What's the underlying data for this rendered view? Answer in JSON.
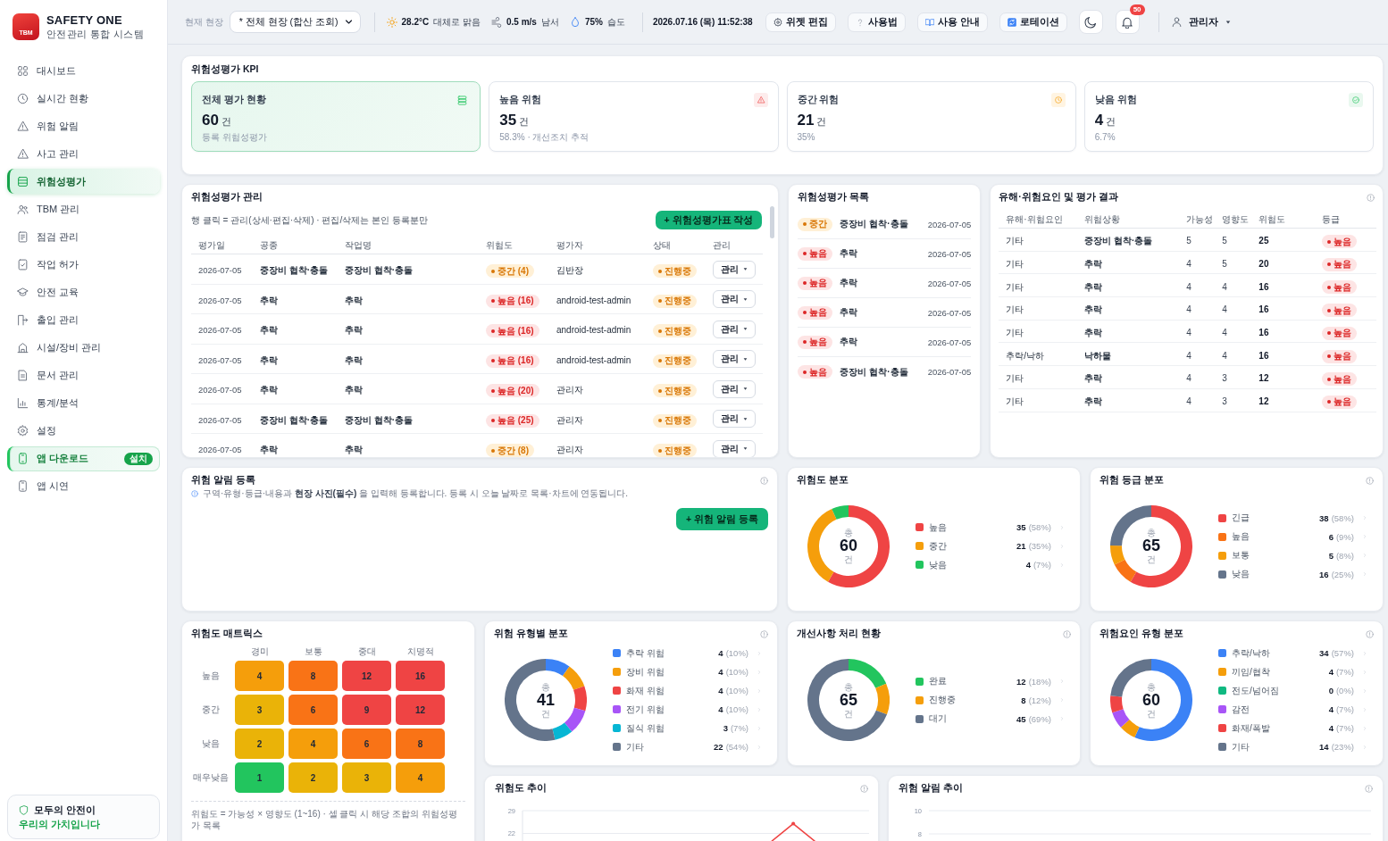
{
  "sidebar": {
    "logo_text": "TBM",
    "title": "SAFETY ONE",
    "subtitle": "안전관리 통합 시스템",
    "nav": [
      {
        "label": "대시보드",
        "selected": false,
        "highlighted": false
      },
      {
        "label": "실시간 현황",
        "selected": false,
        "highlighted": false
      },
      {
        "label": "위험 알림",
        "selected": false,
        "highlighted": false
      },
      {
        "label": "사고 관리",
        "selected": false,
        "highlighted": false
      },
      {
        "label": "위험성평가",
        "selected": true,
        "highlighted": false
      },
      {
        "label": "TBM 관리",
        "selected": false,
        "highlighted": false
      },
      {
        "label": "점검 관리",
        "selected": false,
        "highlighted": false
      },
      {
        "label": "작업 허가",
        "selected": false,
        "highlighted": false
      },
      {
        "label": "안전 교육",
        "selected": false,
        "highlighted": false
      },
      {
        "label": "출입 관리",
        "selected": false,
        "highlighted": false
      },
      {
        "label": "시설/장비 관리",
        "selected": false,
        "highlighted": false
      },
      {
        "label": "문서 관리",
        "selected": false,
        "highlighted": false
      },
      {
        "label": "통계/분석",
        "selected": false,
        "highlighted": false
      },
      {
        "label": "설정",
        "selected": false,
        "highlighted": false
      },
      {
        "label": "앱 다운로드",
        "selected": false,
        "highlighted": true,
        "badge": "설치"
      },
      {
        "label": "앱 시연",
        "selected": false,
        "highlighted": false
      }
    ],
    "slogan": {
      "line1": "모두의 안전이",
      "line2": "우리의 가치입니다"
    }
  },
  "header": {
    "site_label": "현재 현장",
    "site_select": "* 전체 현장 (합산 조회)",
    "weather": [
      {
        "value": "28.2°C",
        "text": "대체로 맑음"
      },
      {
        "value": "0.5 m/s",
        "text": "남서"
      },
      {
        "value": "75%",
        "text": "습도"
      }
    ],
    "datetime": "2026.07.16 (목) 11:52:38",
    "buttons": [
      "위젯 편집",
      "사용법",
      "사용 안내",
      "로테이션"
    ],
    "notification_count": "50",
    "user": "관리자"
  },
  "kpi": {
    "title": "위험성평가 KPI",
    "items": [
      {
        "kind": "total",
        "title": "전체 평가 현황",
        "value": "60",
        "unit": "건",
        "caption": "등록 위험성평가",
        "selected": true
      },
      {
        "kind": "high",
        "title": "높음 위험",
        "value": "35",
        "unit": "건",
        "caption": "58.3% · 개선조치 추적",
        "selected": false
      },
      {
        "kind": "medium",
        "title": "중간 위험",
        "value": "21",
        "unit": "건",
        "caption": "35%",
        "selected": false
      },
      {
        "kind": "low",
        "title": "낮음 위험",
        "value": "4",
        "unit": "건",
        "caption": "6.7%",
        "selected": false
      }
    ]
  },
  "assessment_table": {
    "title": "위험성평가 관리",
    "hint": "행 클릭 = 관리(상세·편집·삭제) · 편집/삭제는 본인 등록분만",
    "create_button": "+ 위험성평가표 작성",
    "columns": [
      "평가일",
      "공종",
      "작업명",
      "위험도",
      "평가자",
      "상태",
      "관리"
    ],
    "rows": [
      {
        "date": "2026-07-05",
        "trade": "중장비 협착·충돌",
        "task": "중장비 협착·충돌",
        "risk": {
          "label": "중간 (4)",
          "kind": "medium"
        },
        "assessor": "김반장",
        "status": {
          "label": "진행중",
          "kind": "ongoing"
        },
        "action": "관리"
      },
      {
        "date": "2026-07-05",
        "trade": "추락",
        "task": "추락",
        "risk": {
          "label": "높음 (16)",
          "kind": "high"
        },
        "assessor": "android-test-admin",
        "status": {
          "label": "진행중",
          "kind": "ongoing"
        },
        "action": "관리"
      },
      {
        "date": "2026-07-05",
        "trade": "추락",
        "task": "추락",
        "risk": {
          "label": "높음 (16)",
          "kind": "high"
        },
        "assessor": "android-test-admin",
        "status": {
          "label": "진행중",
          "kind": "ongoing"
        },
        "action": "관리"
      },
      {
        "date": "2026-07-05",
        "trade": "추락",
        "task": "추락",
        "risk": {
          "label": "높음 (16)",
          "kind": "high"
        },
        "assessor": "android-test-admin",
        "status": {
          "label": "진행중",
          "kind": "ongoing"
        },
        "action": "관리"
      },
      {
        "date": "2026-07-05",
        "trade": "추락",
        "task": "추락",
        "risk": {
          "label": "높음 (20)",
          "kind": "high"
        },
        "assessor": "관리자",
        "status": {
          "label": "진행중",
          "kind": "ongoing"
        },
        "action": "관리"
      },
      {
        "date": "2026-07-05",
        "trade": "중장비 협착·충돌",
        "task": "중장비 협착·충돌",
        "risk": {
          "label": "높음 (25)",
          "kind": "high"
        },
        "assessor": "관리자",
        "status": {
          "label": "진행중",
          "kind": "ongoing"
        },
        "action": "관리"
      },
      {
        "date": "2026-07-05",
        "trade": "추락",
        "task": "추락",
        "risk": {
          "label": "중간 (8)",
          "kind": "medium"
        },
        "assessor": "관리자",
        "status": {
          "label": "진행중",
          "kind": "ongoing"
        },
        "action": "관리"
      }
    ]
  },
  "assessment_list": {
    "title": "위험성평가 목록",
    "items": [
      {
        "kind": "medium",
        "badge": "중간",
        "title": "중장비 협착·충돌",
        "date": "2026-07-05"
      },
      {
        "kind": "high",
        "badge": "높음",
        "title": "추락",
        "date": "2026-07-05"
      },
      {
        "kind": "high",
        "badge": "높음",
        "title": "추락",
        "date": "2026-07-05"
      },
      {
        "kind": "high",
        "badge": "높음",
        "title": "추락",
        "date": "2026-07-05"
      },
      {
        "kind": "high",
        "badge": "높음",
        "title": "추락",
        "date": "2026-07-05"
      },
      {
        "kind": "high",
        "badge": "높음",
        "title": "중장비 협착·충돌",
        "date": "2026-07-05"
      }
    ]
  },
  "hazard_results": {
    "title": "유해·위험요인 및 평가 결과",
    "info": true,
    "columns": [
      "유해·위험요인",
      "위험상황",
      "가능성",
      "영향도",
      "위험도",
      "등급"
    ],
    "rows": [
      {
        "factor": "기타",
        "situation": "중장비 협착·충돌",
        "likelihood": "5",
        "impact": "5",
        "risk": "25",
        "grade": {
          "label": "높음",
          "kind": "high"
        }
      },
      {
        "factor": "기타",
        "situation": "추락",
        "likelihood": "4",
        "impact": "5",
        "risk": "20",
        "grade": {
          "label": "높음",
          "kind": "high"
        }
      },
      {
        "factor": "기타",
        "situation": "추락",
        "likelihood": "4",
        "impact": "4",
        "risk": "16",
        "grade": {
          "label": "높음",
          "kind": "high"
        }
      },
      {
        "factor": "기타",
        "situation": "추락",
        "likelihood": "4",
        "impact": "4",
        "risk": "16",
        "grade": {
          "label": "높음",
          "kind": "high"
        }
      },
      {
        "factor": "기타",
        "situation": "추락",
        "likelihood": "4",
        "impact": "4",
        "risk": "16",
        "grade": {
          "label": "높음",
          "kind": "high"
        }
      },
      {
        "factor": "추락/낙하",
        "situation": "낙하물",
        "likelihood": "4",
        "impact": "4",
        "risk": "16",
        "grade": {
          "label": "높음",
          "kind": "high"
        }
      },
      {
        "factor": "기타",
        "situation": "추락",
        "likelihood": "4",
        "impact": "3",
        "risk": "12",
        "grade": {
          "label": "높음",
          "kind": "high"
        }
      },
      {
        "factor": "기타",
        "situation": "추락",
        "likelihood": "4",
        "impact": "3",
        "risk": "12",
        "grade": {
          "label": "높음",
          "kind": "high"
        }
      }
    ]
  },
  "alert_registration": {
    "title": "위험 알림 등록",
    "info": true,
    "hint": "구역·유형·등급·내용과 **현장 사진(필수)** 을 입력해 등록합니다. 등록 시 오늘 날짜로 목록·차트에 연동됩니다.",
    "button": "+ 위험 알림 등록"
  },
  "donut_cards": [
    {
      "title": "위험도 분포",
      "info": false,
      "total_label": "총",
      "total": "60",
      "total_unit": "건",
      "chart_data": {
        "type": "donut",
        "categories": [
          "높음",
          "중간",
          "낮음"
        ],
        "values": [
          58.33,
          35,
          6.67
        ],
        "legend": "right"
      },
      "legend": [
        {
          "count": "35",
          "share": "(58%)",
          "color": "#ef4444"
        },
        {
          "count": "21",
          "share": "(35%)",
          "color": "#f59e0b"
        },
        {
          "count": "4",
          "share": "(7%)",
          "color": "#22c55e"
        }
      ]
    },
    {
      "title": "위험 등급 분포",
      "info": true,
      "total_label": "총",
      "total": "65",
      "total_unit": "건",
      "chart_data": {
        "type": "donut",
        "categories": [
          "긴급",
          "높음",
          "보통",
          "낮음"
        ],
        "values": [
          58.46,
          9.23,
          7.69,
          24.62
        ],
        "legend": "right"
      },
      "legend": [
        {
          "count": "38",
          "share": "(58%)",
          "color": "#ef4444"
        },
        {
          "count": "6",
          "share": "(9%)",
          "color": "#f97316"
        },
        {
          "count": "5",
          "share": "(8%)",
          "color": "#f59e0b"
        },
        {
          "count": "16",
          "share": "(25%)",
          "color": "#64748b"
        }
      ]
    },
    {
      "title": "위험 유형별 분포",
      "info": true,
      "total_label": "총",
      "total": "41",
      "total_unit": "건",
      "chart_data": {
        "type": "donut",
        "categories": [
          "추락 위험",
          "장비 위험",
          "화재 위험",
          "전기 위험",
          "질식 위험",
          "기타"
        ],
        "values": [
          9.76,
          9.76,
          9.76,
          9.76,
          7.32,
          53.64
        ],
        "legend": "right"
      },
      "legend": [
        {
          "count": "4",
          "share": "(10%)",
          "color": "#3b82f6"
        },
        {
          "count": "4",
          "share": "(10%)",
          "color": "#f59e0b"
        },
        {
          "count": "4",
          "share": "(10%)",
          "color": "#ef4444"
        },
        {
          "count": "4",
          "share": "(10%)",
          "color": "#a855f7"
        },
        {
          "count": "3",
          "share": "(7%)",
          "color": "#06b6d4"
        },
        {
          "count": "22",
          "share": "(54%)",
          "color": "#64748b"
        }
      ]
    },
    {
      "title": "개선사항 처리 현황",
      "info": true,
      "total_label": "총",
      "total": "65",
      "total_unit": "건",
      "chart_data": {
        "type": "donut",
        "categories": [
          "완료",
          "진행중",
          "대기"
        ],
        "values": [
          18.46,
          12.31,
          69.23
        ],
        "legend": "right"
      },
      "legend": [
        {
          "count": "12",
          "share": "(18%)",
          "color": "#22c55e"
        },
        {
          "count": "8",
          "share": "(12%)",
          "color": "#f59e0b"
        },
        {
          "count": "45",
          "share": "(69%)",
          "color": "#64748b"
        }
      ]
    },
    {
      "title": "위험요인 유형 분포",
      "info": true,
      "total_label": "총",
      "total": "60",
      "total_unit": "건",
      "chart_data": {
        "type": "donut",
        "categories": [
          "추락/낙하",
          "끼임/협착",
          "전도/넘어짐",
          "감전",
          "화재/폭발",
          "기타"
        ],
        "values": [
          56.66,
          6.67,
          0,
          6.67,
          6.67,
          23.33
        ],
        "legend": "right"
      },
      "legend": [
        {
          "count": "34",
          "share": "(57%)",
          "color": "#3b82f6"
        },
        {
          "count": "4",
          "share": "(7%)",
          "color": "#f59e0b"
        },
        {
          "count": "0",
          "share": "(0%)",
          "color": "#10b981"
        },
        {
          "count": "4",
          "share": "(7%)",
          "color": "#a855f7"
        },
        {
          "count": "4",
          "share": "(7%)",
          "color": "#ef4444"
        },
        {
          "count": "14",
          "share": "(23%)",
          "color": "#64748b"
        }
      ]
    }
  ],
  "risk_matrix": {
    "title": "위험도 매트릭스",
    "columns": [
      "경미",
      "보통",
      "중대",
      "치명적"
    ],
    "rows": [
      {
        "label": "높음",
        "cells": [
          {
            "value": "4",
            "color": "#f59e0b"
          },
          {
            "value": "8",
            "color": "#f97316"
          },
          {
            "value": "12",
            "color": "#ef4444"
          },
          {
            "value": "16",
            "color": "#ef4444"
          }
        ]
      },
      {
        "label": "중간",
        "cells": [
          {
            "value": "3",
            "color": "#eab308"
          },
          {
            "value": "6",
            "color": "#f97316"
          },
          {
            "value": "9",
            "color": "#ef4444"
          },
          {
            "value": "12",
            "color": "#ef4444"
          }
        ]
      },
      {
        "label": "낮음",
        "cells": [
          {
            "value": "2",
            "color": "#eab308"
          },
          {
            "value": "4",
            "color": "#f59e0b"
          },
          {
            "value": "6",
            "color": "#f97316"
          },
          {
            "value": "8",
            "color": "#f97316"
          }
        ]
      },
      {
        "label": "매우낮음",
        "cells": [
          {
            "value": "1",
            "color": "#22c55e"
          },
          {
            "value": "2",
            "color": "#eab308"
          },
          {
            "value": "3",
            "color": "#eab308"
          },
          {
            "value": "4",
            "color": "#f59e0b"
          }
        ]
      }
    ],
    "footnote": "위험도 = 가능성 × 영향도 (1~16) · 셀 클릭 시 해당 조합의 위험성평가 목록"
  },
  "risk_trend": {
    "title": "위험도 추이",
    "info": true,
    "chart_data": {
      "type": "line",
      "categories": [
        null,
        null,
        null,
        null,
        null,
        null,
        null,
        null,
        null,
        null,
        null,
        null,
        null,
        null,
        null,
        null
      ],
      "ylim": [
        19.4,
        29
      ],
      "yticks": [
        22,
        29
      ],
      "series": [
        {
          "color": "#ef4444",
          "values": [
            null,
            null,
            null,
            null,
            null,
            null,
            null,
            null,
            null,
            null,
            null,
            19.6,
            25,
            19.6,
            null,
            null
          ]
        }
      ]
    }
  },
  "alert_trend": {
    "title": "위험 알림 추이",
    "info": true,
    "axis_labels": [
      "10",
      "8"
    ]
  }
}
